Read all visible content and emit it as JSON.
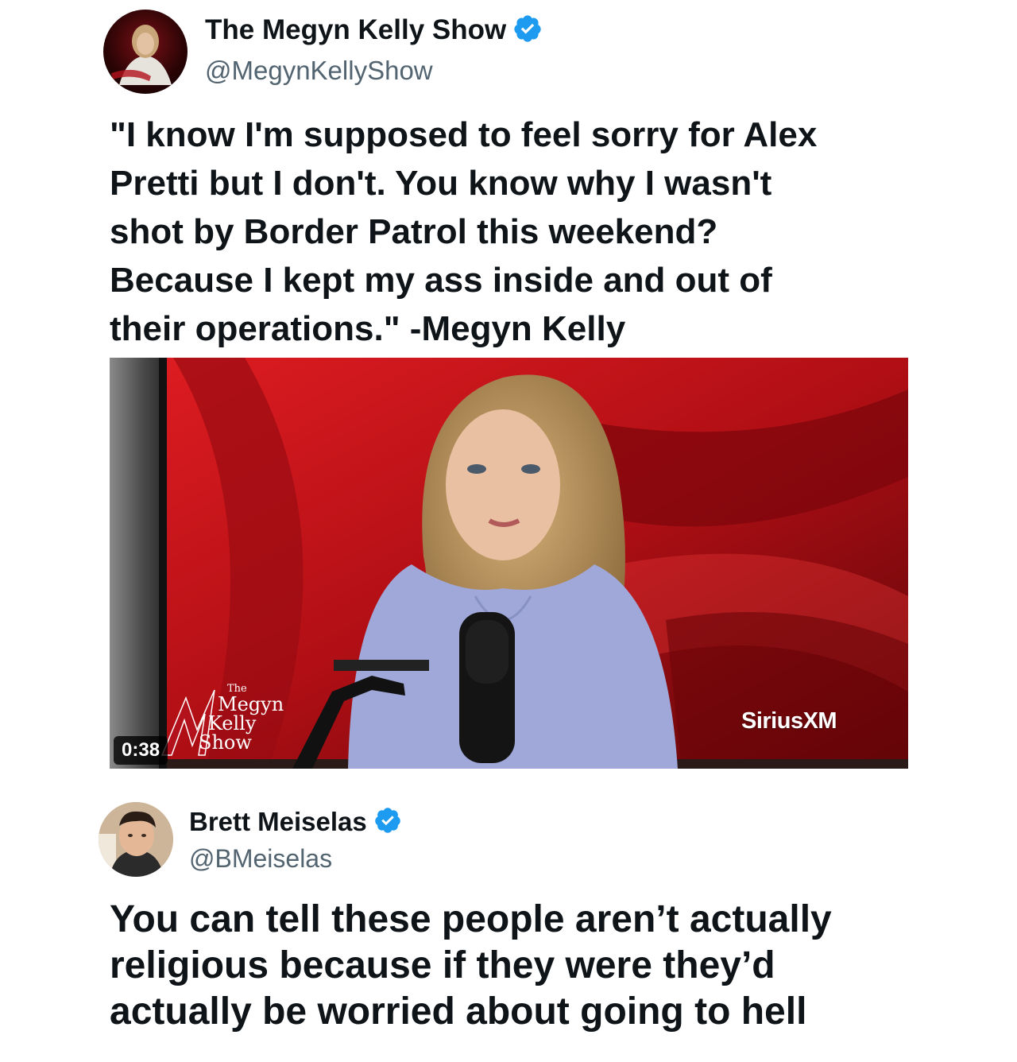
{
  "tweet1": {
    "display_name": "The Megyn Kelly Show",
    "handle": "@MegynKellyShow",
    "verified": true,
    "text_lines": [
      "\"I know I'm supposed to feel sorry for Alex",
      "Pretti but I don't. You know why I wasn't",
      "shot by Border Patrol this weekend?",
      "Because I kept my ass inside and out of",
      "their operations.\" -Megyn Kelly"
    ],
    "video": {
      "duration": "0:38",
      "watermark": "SiriusXM",
      "show_logo": {
        "the": "The",
        "megyn": "Megyn",
        "kelly": "Kelly",
        "show": "Show"
      }
    }
  },
  "tweet2": {
    "display_name": "Brett Meiselas",
    "handle": "@BMeiselas",
    "verified": true,
    "text_lines": [
      "You can tell these people aren’t actually",
      "religious because if they were they’d",
      "actually be worried about going to hell"
    ]
  },
  "colors": {
    "verified_blue": "#1d9bf0",
    "handle_gray": "#536471",
    "text": "#0f1419",
    "studio_red": "#c8141c"
  },
  "icons": [
    "verified-badge-icon",
    "play-duration-badge"
  ]
}
